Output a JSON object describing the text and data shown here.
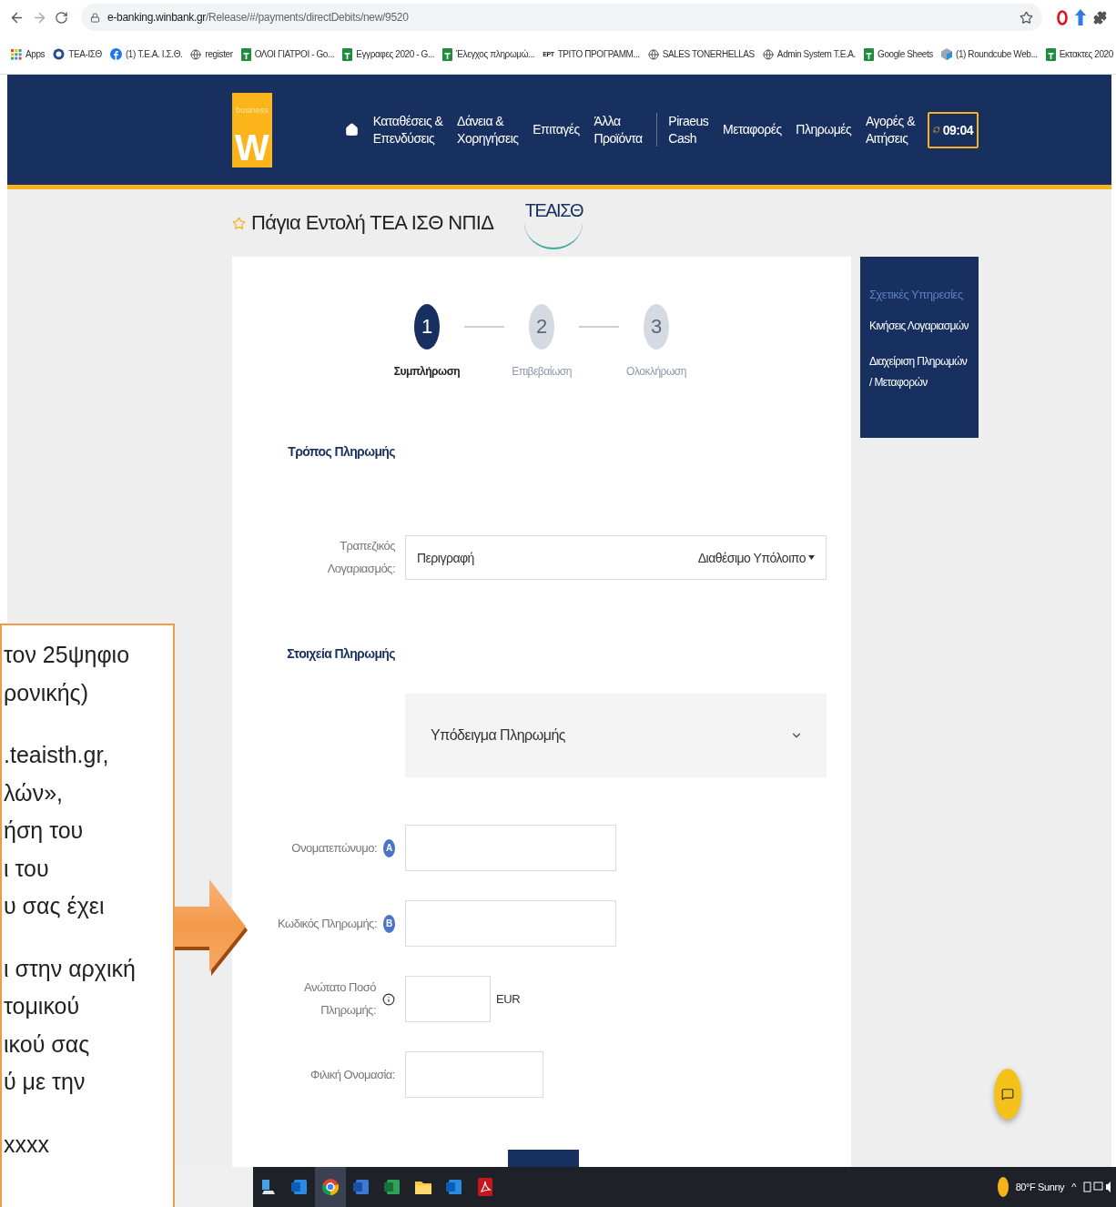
{
  "browser": {
    "url_host": "e-banking.winbank.gr",
    "url_path": "/Release/#/payments/directDebits/new/9520"
  },
  "bookmarks": [
    {
      "kind": "apps",
      "label": "Apps"
    },
    {
      "kind": "emblem",
      "label": "ΤΕΑ-ΙΣΘ"
    },
    {
      "kind": "facebook",
      "label": "(1) Τ.Ε.Α. Ι.Σ.Θ."
    },
    {
      "kind": "globe",
      "label": "register"
    },
    {
      "kind": "sheet",
      "label": "ΟΛΟΙ ΓΙΑΤΡΟΙ - Go..."
    },
    {
      "kind": "sheet",
      "label": "Εγγραφες 2020 - G..."
    },
    {
      "kind": "sheet",
      "label": "Έλεγχος πληρωμώ..."
    },
    {
      "kind": "tag",
      "label": "ΤΡΙΤΟ ΠΡΟΓΡΑΜΜ...",
      "icon_text": "ΕΡΤ"
    },
    {
      "kind": "globe",
      "label": "SALES TONERHELLAS"
    },
    {
      "kind": "globe",
      "label": "Admin System T.E.A."
    },
    {
      "kind": "sheet",
      "label": "Google Sheets"
    },
    {
      "kind": "mail",
      "label": "(1) Roundcube Web..."
    },
    {
      "kind": "sheet",
      "label": "Εκτακτες 2020"
    }
  ],
  "header": {
    "logo_small": "business",
    "logo_letter": "W",
    "timer": "09:04",
    "nav": [
      {
        "label": "Καταθέσεις &\nΕπενδύσεις",
        "divider_before": false
      },
      {
        "label": "Δάνεια &\nΧορηγήσεις",
        "divider_before": false
      },
      {
        "label": "Επιταγές",
        "divider_before": false
      },
      {
        "label": "Άλλα\nΠροϊόντα",
        "divider_before": false
      },
      {
        "label": "Piraeus\nCash",
        "divider_before": true
      },
      {
        "label": "Μεταφορές",
        "divider_before": false
      },
      {
        "label": "Πληρωμές",
        "divider_before": false
      },
      {
        "label": "Αγορές &\nΑιτήσεις",
        "divider_before": false
      }
    ]
  },
  "title": "Πάγια Εντολή ΤΕΑ ΙΣΘ ΝΠΙΔ",
  "title_logo": "ΤΕΑΙΣΘ",
  "steps": [
    {
      "number": "1",
      "label": "Συμπλήρωση",
      "selected": true
    },
    {
      "number": "2",
      "label": "Επιβεβαίωση",
      "selected": false
    },
    {
      "number": "3",
      "label": "Ολοκλήρωση",
      "selected": false
    }
  ],
  "form": [
    {
      "kind": "heading",
      "label": "Τρόπος Πληρωμής"
    },
    {
      "kind": "account",
      "label": "Τραπεζικός\nΛογαριασμός:",
      "value": "Περιγραφή",
      "balance": "Διαθέσιμο Υπόλοιπο"
    },
    {
      "kind": "heading",
      "label": "Στοιχεία Πληρωμής"
    },
    {
      "kind": "template",
      "value": "Υπόδειγμα Πληρωμής"
    },
    {
      "kind": "input",
      "label": "Ονοματεπώνυμο:",
      "badge": "A"
    },
    {
      "kind": "input",
      "label": "Κωδικός Πληρωμής:",
      "badge": "B"
    },
    {
      "kind": "amount",
      "label": "Ανώτατο Ποσό\nΠληρωμής:",
      "unit": "EUR"
    },
    {
      "kind": "input",
      "label": "Φιλική Ονομασία:"
    }
  ],
  "side_panel": {
    "title": "Σχετικές Υπηρεσίες",
    "links": [
      "Κινήσεις Λογαριασμών",
      "Διαχείριση Πληρωμών / Μεταφορών"
    ]
  },
  "note": {
    "paragraphs": [
      [
        "τον 25ψηφιο",
        "ρονικής)"
      ],
      [
        ".teaisth.gr,",
        "λών»,",
        "ήση του",
        "ι του",
        "υ σας έχει"
      ],
      [
        "ι στην αρχική",
        "τομικού",
        "ικού σας",
        "ύ με την"
      ],
      [
        "xxxx"
      ]
    ]
  },
  "taskbar": {
    "apps": [
      {
        "kind": "pc",
        "selected": false
      },
      {
        "kind": "outlook",
        "selected": false
      },
      {
        "kind": "chrome",
        "selected": true
      },
      {
        "kind": "word",
        "selected": false
      },
      {
        "kind": "excel",
        "selected": false
      },
      {
        "kind": "folder",
        "selected": false
      },
      {
        "kind": "outlook",
        "selected": false
      },
      {
        "kind": "pdf",
        "selected": false
      }
    ],
    "weather": "80°F Sunny",
    "tray_caret": "^"
  }
}
